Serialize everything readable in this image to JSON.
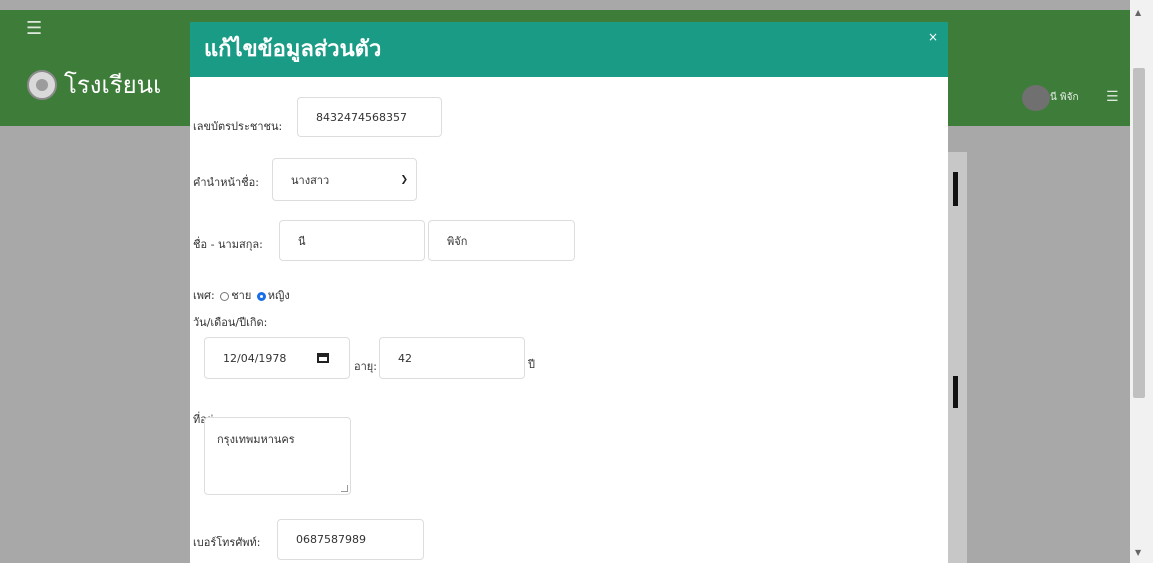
{
  "page": {
    "school_name": "โรงเรียนเ",
    "user_name": "นี พิจัก"
  },
  "modal": {
    "title": "แก้ไขข้อมูลส่วนตัว",
    "close_label": "×",
    "id_card": {
      "label": "เลขบัตรประชาชน:",
      "value": "8432474568357"
    },
    "prefix": {
      "label": "คำนำหน้าชื่อ:",
      "selected": "นางสาว"
    },
    "name": {
      "label": "ชื่อ - นามสกุล:",
      "first": "นี",
      "last": "พิจัก"
    },
    "gender": {
      "label": "เพศ:",
      "options": [
        "ชาย",
        "หญิง"
      ],
      "selected": "หญิง"
    },
    "birthdate": {
      "label": "วัน/เดือน/ปีเกิด:",
      "value": "12/04/1978"
    },
    "age": {
      "label": "อายุ:",
      "value": "42",
      "unit": "ปี"
    },
    "address": {
      "label": "ที่อยู่:",
      "value": "กรุงเทพมหานคร"
    },
    "phone": {
      "label": "เบอร์โทรศัพท์:",
      "value": "0687587989"
    }
  },
  "colors": {
    "header_bg": "#3e7c3a",
    "modal_header_bg": "#1a9b86",
    "overlay_bg": "#a8a8a8",
    "radio_selected": "#1a6fe8"
  },
  "icons": [
    "hamburger-icon",
    "school-logo",
    "avatar",
    "calendar-icon",
    "chevron-down-icon",
    "close-icon"
  ]
}
